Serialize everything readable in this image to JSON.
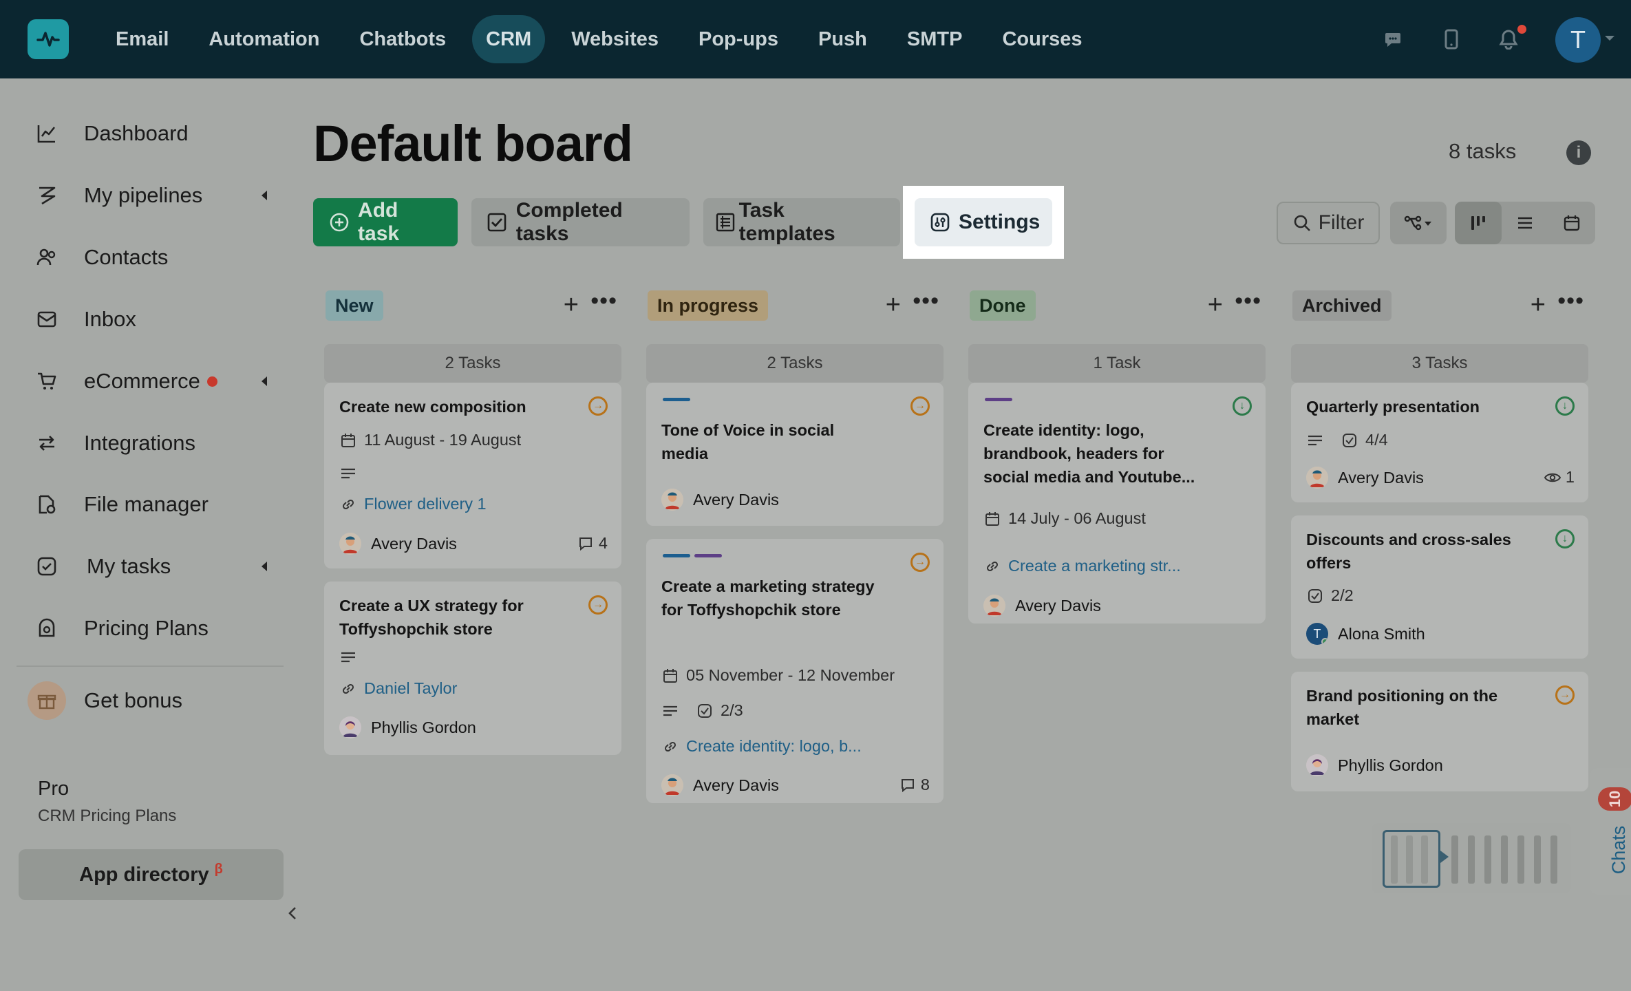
{
  "topnav": {
    "items": [
      "Email",
      "Automation",
      "Chatbots",
      "CRM",
      "Websites",
      "Pop-ups",
      "Push",
      "SMTP",
      "Courses"
    ],
    "active": "CRM",
    "avatar_initial": "T"
  },
  "sidebar": {
    "items": [
      {
        "label": "Dashboard",
        "icon": "chart-line-icon"
      },
      {
        "label": "My pipelines",
        "icon": "pipeline-icon"
      },
      {
        "label": "Contacts",
        "icon": "contacts-icon"
      },
      {
        "label": "Inbox",
        "icon": "inbox-icon"
      },
      {
        "label": "eCommerce",
        "icon": "cart-icon"
      },
      {
        "label": "Integrations",
        "icon": "integrations-icon"
      },
      {
        "label": "File manager",
        "icon": "file-manager-icon"
      },
      {
        "label": "My tasks",
        "icon": "task-check-icon"
      },
      {
        "label": "Pricing Plans",
        "icon": "pricing-icon"
      }
    ],
    "bonus_label": "Get bonus",
    "plan_title": "Pro",
    "plan_subtitle": "CRM Pricing Plans",
    "app_directory": "App directory",
    "app_directory_badge": "β"
  },
  "header": {
    "title": "Default board",
    "tasks_count": "8 tasks",
    "info": "i"
  },
  "toolbar": {
    "add_task": "Add task",
    "completed_tasks": "Completed tasks",
    "task_templates": "Task templates",
    "settings": "Settings",
    "filter": "Filter"
  },
  "columns": [
    {
      "name": "New",
      "tag_color": "#88a9ab",
      "count": "2 Tasks",
      "cards": [
        {
          "title": "Create new composition",
          "dates": "11 August  - 19 August",
          "link": "Flower delivery 1",
          "assignee": "Avery Davis",
          "comments": "4",
          "status": "orange"
        },
        {
          "title": "Create a UX strategy for Toffyshopchik store",
          "link": "Daniel Taylor",
          "assignee": "Phyllis Gordon",
          "status": "orange"
        }
      ]
    },
    {
      "name": "In progress",
      "tag_color": "#b19e7a",
      "count": "2 Tasks",
      "cards": [
        {
          "title": "Tone of Voice in social media",
          "assignee": "Avery Davis",
          "status": "orange",
          "bars": [
            "#1c5e8f"
          ]
        },
        {
          "title": "Create a marketing strategy for Toffyshopchik store",
          "dates": "05 November  - 12 November",
          "checklist": "2/3",
          "link": "Create identity: logo, b...",
          "assignee": "Avery Davis",
          "comments": "8",
          "status": "orange",
          "bars": [
            "#1c5e8f",
            "#5d3f86"
          ]
        }
      ]
    },
    {
      "name": "Done",
      "tag_color": "#8fa890",
      "count": "1 Task",
      "cards": [
        {
          "title": "Create identity: logo, brandbook, headers for social media and Youtube...",
          "dates": "14 July  - 06 August",
          "link": "Create a marketing str...",
          "assignee": "Avery Davis",
          "status": "green",
          "bars": [
            "#5d3f86"
          ]
        }
      ]
    },
    {
      "name": "Archived",
      "tag_color": "#999b99",
      "count": "3 Tasks",
      "cards": [
        {
          "title": "Quarterly presentation",
          "checklist": "4/4",
          "assignee": "Avery Davis",
          "watchers": "1",
          "status": "green"
        },
        {
          "title": "Discounts and cross-sales offers",
          "checklist": "2/2",
          "assignee": "Alona Smith",
          "assignee_initial": "T",
          "status": "green"
        },
        {
          "title": "Brand positioning on the market",
          "assignee": "Phyllis Gordon",
          "status": "orange"
        }
      ]
    }
  ],
  "chats": {
    "label": "Chats",
    "badge": "10"
  }
}
